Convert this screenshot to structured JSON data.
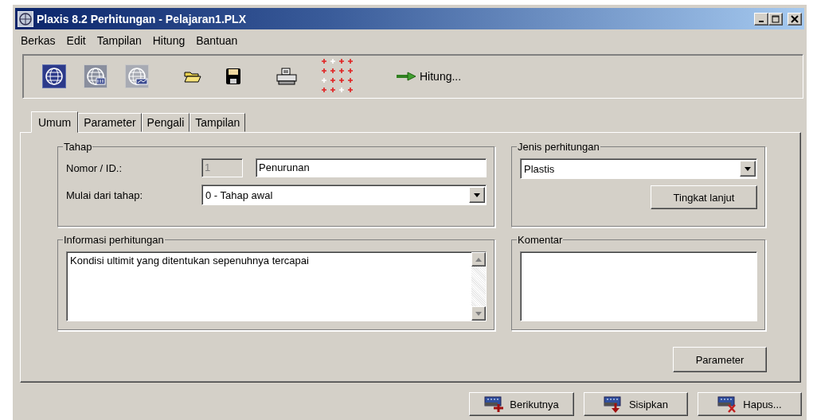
{
  "window": {
    "title": "Plaxis 8.2 Perhitungan - Pelajaran1.PLX"
  },
  "menu": [
    {
      "label": "Berkas"
    },
    {
      "label": "Edit"
    },
    {
      "label": "Tampilan"
    },
    {
      "label": "Hitung"
    },
    {
      "label": "Bantuan"
    }
  ],
  "toolbar": {
    "program_buttons": [
      {
        "kind": "globe",
        "selected": true
      },
      {
        "kind": "globe-grid",
        "selected": false
      },
      {
        "kind": "globe-chart",
        "selected": false
      }
    ],
    "tools": [
      {
        "kind": "folder"
      },
      {
        "kind": "floppy"
      },
      {
        "kind": "printer"
      },
      {
        "kind": "plus-grid"
      }
    ],
    "run_button": {
      "label": "Hitung..."
    }
  },
  "tabs": [
    {
      "label": "Umum",
      "selected": true
    },
    {
      "label": "Parameter",
      "selected": false
    },
    {
      "label": "Pengali",
      "selected": false
    },
    {
      "label": "Tampilan",
      "selected": false
    }
  ],
  "phase_group": {
    "title": "Tahap",
    "number_label": "Nomor / ID.:",
    "number": {
      "value": "1",
      "disabled": true
    },
    "name": {
      "value": "Penurunan",
      "disabled": false
    },
    "start_label": "Mulai dari tahap:",
    "start_phase": "0 - Tahap awal"
  },
  "calculation_type_group": {
    "title": "Jenis perhitungan",
    "value": "Plastis",
    "advanced_button": "Tingkat lanjut"
  },
  "info_group": {
    "title": "Informasi perhitungan",
    "text": "Kondisi ultimit yang ditentukan sepenuhnya tercapai"
  },
  "comment_group": {
    "title": "Komentar"
  },
  "parameter_button": "Parameter",
  "bottom_buttons": [
    {
      "kind": "add",
      "label": "Berikutnya"
    },
    {
      "kind": "insert",
      "label": "Sisipkan"
    },
    {
      "kind": "delete",
      "label": "Hapus..."
    }
  ]
}
